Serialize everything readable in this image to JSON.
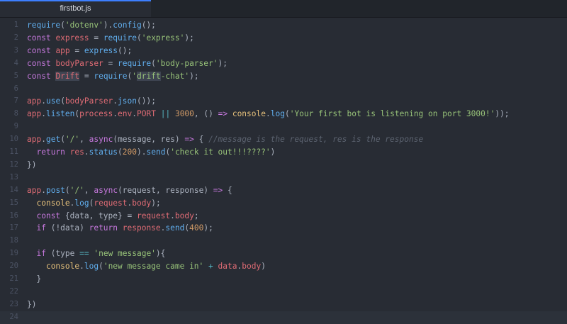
{
  "tab": {
    "filename": "firstbot.js"
  },
  "colors": {
    "background": "#282c34",
    "keyword": "#c678dd",
    "function": "#61afef",
    "variable": "#e06c75",
    "string": "#98c379",
    "number": "#d19a66",
    "operator": "#56b6c2",
    "comment": "#5c6370",
    "class": "#e5c07b",
    "tab_accent": "#3d7fff"
  },
  "editor": {
    "cursor_line": 24,
    "lines": [
      {
        "n": "1",
        "tokens": [
          [
            "fn",
            "require"
          ],
          [
            "plain",
            "("
          ],
          [
            "str",
            "'dotenv'"
          ],
          [
            "plain",
            ")."
          ],
          [
            "fn",
            "config"
          ],
          [
            "plain",
            "();"
          ]
        ]
      },
      {
        "n": "2",
        "tokens": [
          [
            "kw",
            "const"
          ],
          [
            "plain",
            " "
          ],
          [
            "var",
            "express"
          ],
          [
            "plain",
            " = "
          ],
          [
            "fn",
            "require"
          ],
          [
            "plain",
            "("
          ],
          [
            "str",
            "'express'"
          ],
          [
            "plain",
            ");"
          ]
        ]
      },
      {
        "n": "3",
        "tokens": [
          [
            "kw",
            "const"
          ],
          [
            "plain",
            " "
          ],
          [
            "var",
            "app"
          ],
          [
            "plain",
            " = "
          ],
          [
            "fn",
            "express"
          ],
          [
            "plain",
            "();"
          ]
        ]
      },
      {
        "n": "4",
        "tokens": [
          [
            "kw",
            "const"
          ],
          [
            "plain",
            " "
          ],
          [
            "var",
            "bodyParser"
          ],
          [
            "plain",
            " = "
          ],
          [
            "fn",
            "require"
          ],
          [
            "plain",
            "("
          ],
          [
            "str",
            "'body-parser'"
          ],
          [
            "plain",
            ");"
          ]
        ]
      },
      {
        "n": "5",
        "tokens": [
          [
            "kw",
            "const"
          ],
          [
            "plain",
            " "
          ],
          [
            "var_sel",
            "Drift"
          ],
          [
            "plain",
            " = "
          ],
          [
            "fn",
            "require"
          ],
          [
            "plain",
            "("
          ],
          [
            "str",
            "'"
          ],
          [
            "str_sel",
            "drift"
          ],
          [
            "str",
            "-chat'"
          ],
          [
            "plain",
            ");"
          ]
        ]
      },
      {
        "n": "6",
        "tokens": []
      },
      {
        "n": "7",
        "tokens": [
          [
            "var",
            "app"
          ],
          [
            "plain",
            "."
          ],
          [
            "fn",
            "use"
          ],
          [
            "plain",
            "("
          ],
          [
            "var",
            "bodyParser"
          ],
          [
            "plain",
            "."
          ],
          [
            "fn",
            "json"
          ],
          [
            "plain",
            "());"
          ]
        ]
      },
      {
        "n": "8",
        "tokens": [
          [
            "var",
            "app"
          ],
          [
            "plain",
            "."
          ],
          [
            "fn",
            "listen"
          ],
          [
            "plain",
            "("
          ],
          [
            "var",
            "process"
          ],
          [
            "plain",
            "."
          ],
          [
            "var",
            "env"
          ],
          [
            "plain",
            "."
          ],
          [
            "var",
            "PORT"
          ],
          [
            "plain",
            " "
          ],
          [
            "op",
            "||"
          ],
          [
            "plain",
            " "
          ],
          [
            "num",
            "3000"
          ],
          [
            "plain",
            ", () "
          ],
          [
            "kw",
            "=>"
          ],
          [
            "plain",
            " "
          ],
          [
            "cls",
            "console"
          ],
          [
            "plain",
            "."
          ],
          [
            "fn",
            "log"
          ],
          [
            "plain",
            "("
          ],
          [
            "str",
            "'Your first bot is listening on port 3000!'"
          ],
          [
            "plain",
            "));"
          ]
        ]
      },
      {
        "n": "9",
        "tokens": []
      },
      {
        "n": "10",
        "tokens": [
          [
            "var",
            "app"
          ],
          [
            "plain",
            "."
          ],
          [
            "fn",
            "get"
          ],
          [
            "plain",
            "("
          ],
          [
            "str",
            "'/'"
          ],
          [
            "plain",
            ", "
          ],
          [
            "kw",
            "async"
          ],
          [
            "plain",
            "(message, res) "
          ],
          [
            "kw",
            "=>"
          ],
          [
            "plain",
            " { "
          ],
          [
            "com",
            "//message is the request, res is the response"
          ]
        ]
      },
      {
        "n": "11",
        "tokens": [
          [
            "plain",
            "  "
          ],
          [
            "kw",
            "return"
          ],
          [
            "plain",
            " "
          ],
          [
            "var",
            "res"
          ],
          [
            "plain",
            "."
          ],
          [
            "fn",
            "status"
          ],
          [
            "plain",
            "("
          ],
          [
            "num",
            "200"
          ],
          [
            "plain",
            ")."
          ],
          [
            "fn",
            "send"
          ],
          [
            "plain",
            "("
          ],
          [
            "str",
            "'check it out!!!????'"
          ],
          [
            "plain",
            ")"
          ]
        ]
      },
      {
        "n": "12",
        "tokens": [
          [
            "plain",
            "})"
          ]
        ]
      },
      {
        "n": "13",
        "tokens": []
      },
      {
        "n": "14",
        "tokens": [
          [
            "var",
            "app"
          ],
          [
            "plain",
            "."
          ],
          [
            "fn",
            "post"
          ],
          [
            "plain",
            "("
          ],
          [
            "str",
            "'/'"
          ],
          [
            "plain",
            ", "
          ],
          [
            "kw",
            "async"
          ],
          [
            "plain",
            "(request, response) "
          ],
          [
            "kw",
            "=>"
          ],
          [
            "plain",
            " {"
          ]
        ]
      },
      {
        "n": "15",
        "tokens": [
          [
            "plain",
            "  "
          ],
          [
            "cls",
            "console"
          ],
          [
            "plain",
            "."
          ],
          [
            "fn",
            "log"
          ],
          [
            "plain",
            "("
          ],
          [
            "var",
            "request"
          ],
          [
            "plain",
            "."
          ],
          [
            "var",
            "body"
          ],
          [
            "plain",
            ");"
          ]
        ]
      },
      {
        "n": "16",
        "tokens": [
          [
            "plain",
            "  "
          ],
          [
            "kw",
            "const"
          ],
          [
            "plain",
            " {data, type} = "
          ],
          [
            "var",
            "request"
          ],
          [
            "plain",
            "."
          ],
          [
            "var",
            "body"
          ],
          [
            "plain",
            ";"
          ]
        ]
      },
      {
        "n": "17",
        "tokens": [
          [
            "plain",
            "  "
          ],
          [
            "kw",
            "if"
          ],
          [
            "plain",
            " (!data) "
          ],
          [
            "kw",
            "return"
          ],
          [
            "plain",
            " "
          ],
          [
            "var",
            "response"
          ],
          [
            "plain",
            "."
          ],
          [
            "fn",
            "send"
          ],
          [
            "plain",
            "("
          ],
          [
            "num",
            "400"
          ],
          [
            "plain",
            ");"
          ]
        ]
      },
      {
        "n": "18",
        "tokens": []
      },
      {
        "n": "19",
        "tokens": [
          [
            "plain",
            "  "
          ],
          [
            "kw",
            "if"
          ],
          [
            "plain",
            " (type "
          ],
          [
            "op",
            "=="
          ],
          [
            "plain",
            " "
          ],
          [
            "str",
            "'new message'"
          ],
          [
            "plain",
            "){"
          ]
        ]
      },
      {
        "n": "20",
        "tokens": [
          [
            "plain",
            "    "
          ],
          [
            "cls",
            "console"
          ],
          [
            "plain",
            "."
          ],
          [
            "fn",
            "log"
          ],
          [
            "plain",
            "("
          ],
          [
            "str",
            "'new message came in'"
          ],
          [
            "plain",
            " "
          ],
          [
            "op",
            "+"
          ],
          [
            "plain",
            " "
          ],
          [
            "var",
            "data"
          ],
          [
            "plain",
            "."
          ],
          [
            "var",
            "body"
          ],
          [
            "plain",
            ")"
          ]
        ]
      },
      {
        "n": "21",
        "tokens": [
          [
            "plain",
            "  }"
          ]
        ]
      },
      {
        "n": "22",
        "tokens": []
      },
      {
        "n": "23",
        "tokens": [
          [
            "plain",
            "})"
          ]
        ]
      },
      {
        "n": "24",
        "tokens": []
      }
    ]
  }
}
